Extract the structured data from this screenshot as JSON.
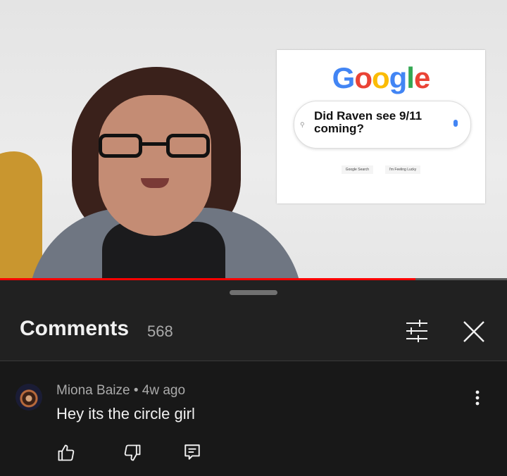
{
  "video": {
    "google_logo": [
      "G",
      "o",
      "o",
      "g",
      "l",
      "e"
    ],
    "google_logo_colors": [
      "#4285F4",
      "#EA4335",
      "#FBBC05",
      "#4285F4",
      "#34A853",
      "#EA4335"
    ],
    "search_query": "Did Raven see 9/11 coming?",
    "search_button": "Google Search",
    "lucky_button": "I'm Feeling Lucky",
    "progress": 0.82
  },
  "comments_panel": {
    "title": "Comments",
    "count": "568",
    "filter_icon": "filter-sliders-icon",
    "close_icon": "close-icon"
  },
  "comment": {
    "author": "Miona Baize",
    "separator": "•",
    "age": "4w ago",
    "text": "Hey its the circle girl",
    "icons": [
      "like-icon",
      "dislike-icon",
      "reply-icon",
      "more-vertical-icon"
    ]
  },
  "colors": {
    "progress_red": "#ff0000",
    "sheet_bg": "#212121",
    "comment_bg": "#181818"
  }
}
